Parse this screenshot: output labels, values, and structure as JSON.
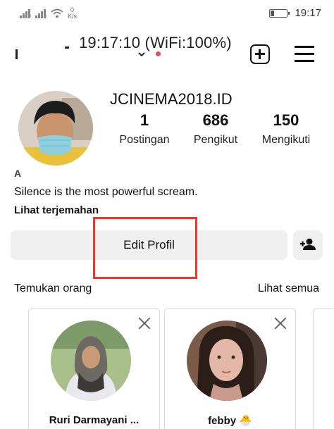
{
  "status_bar": {
    "network_speed_value": "0",
    "network_speed_unit": "K/s",
    "time": "19:17"
  },
  "header": {
    "overlay_text": "19:17:10 (WiFi:100%)",
    "has_notification_dot": true,
    "notification_color": "#ed4956"
  },
  "profile": {
    "username": "JCINEMA2018.ID",
    "stats": [
      {
        "value": "1",
        "label": "Postingan"
      },
      {
        "value": "686",
        "label": "Pengikut"
      },
      {
        "value": "150",
        "label": "Mengikuti"
      }
    ],
    "display_name_partial": "A",
    "bio": "Silence is the most powerful scream.",
    "translate_label": "Lihat terjemahan",
    "edit_button_label": "Edit Profil",
    "add_user_icon": "person-plus-icon"
  },
  "discover": {
    "title": "Temukan orang",
    "see_all": "Lihat semua",
    "cards": [
      {
        "name": "Ruri Darmayani ..."
      },
      {
        "name": "febby 🐣"
      }
    ]
  },
  "colors": {
    "highlight_box": "#e8392b",
    "button_bg": "#efefef"
  }
}
